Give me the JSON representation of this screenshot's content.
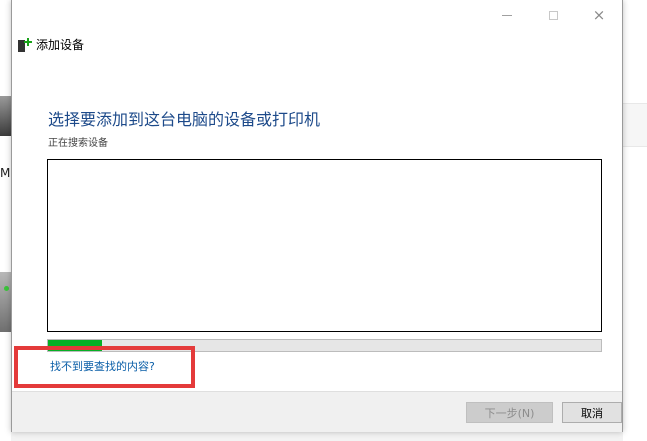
{
  "dialog": {
    "window_title": "添加设备",
    "heading": "选择要添加到这台电脑的设备或打印机",
    "status_text": "正在搜索设备",
    "progress_fraction": 0.097,
    "help_link": "找不到要查找的内容?",
    "buttons": {
      "next": "下一步(N)",
      "cancel": "取消"
    },
    "window_controls": {
      "minimize": "minimize-icon",
      "maximize": "maximize-icon",
      "close": "×"
    }
  },
  "background": {
    "left_partial_text": "M"
  },
  "colors": {
    "heading": "#1d4a8a",
    "link": "#0b5fa8",
    "progress": "#06b025",
    "annotation": "#e43a3a"
  }
}
